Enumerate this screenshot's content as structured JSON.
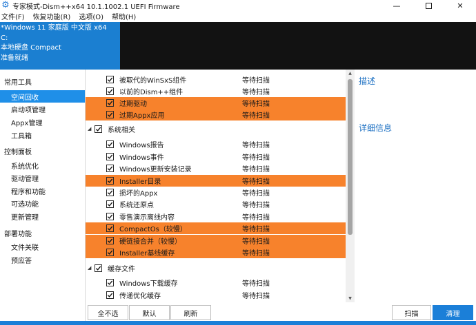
{
  "window": {
    "title": "专家模式-Dism++x64 10.1.1002.1 UEFI Firmware",
    "minimize": "—",
    "close": "✕"
  },
  "menu": [
    "文件(F)",
    "恢复功能(R)",
    "选项(O)",
    "帮助(H)"
  ],
  "header": {
    "os": "*Windows 11 家庭版 中文版 x64",
    "drive": "C:",
    "disk": "本地硬盘 Compact",
    "status": "准备就绪"
  },
  "sidebar": {
    "groups": [
      {
        "label": "常用工具",
        "items": [
          "空间回收",
          "启动项管理",
          "Appx管理",
          "工具箱"
        ]
      },
      {
        "label": "控制面板",
        "items": [
          "系统优化",
          "驱动管理",
          "程序和功能",
          "可选功能",
          "更新管理"
        ]
      },
      {
        "label": "部署功能",
        "items": [
          "文件关联",
          "预应答"
        ]
      }
    ],
    "active": "空间回收"
  },
  "list": {
    "rows": [
      {
        "type": "item",
        "name": "被取代的WinSxS组件",
        "status": "等待扫描",
        "checked": true,
        "highlight": false
      },
      {
        "type": "item",
        "name": "以前的Dism++组件",
        "status": "等待扫描",
        "checked": true,
        "highlight": false
      },
      {
        "type": "item",
        "name": "过期驱动",
        "status": "等待扫描",
        "checked": true,
        "highlight": true
      },
      {
        "type": "item",
        "name": "过期Appx应用",
        "status": "等待扫描",
        "checked": true,
        "highlight": true
      },
      {
        "type": "group",
        "name": "系统相关",
        "status": "",
        "checked": true,
        "highlight": false
      },
      {
        "type": "item",
        "name": "Windows报告",
        "status": "等待扫描",
        "checked": true,
        "highlight": false
      },
      {
        "type": "item",
        "name": "Windows事件",
        "status": "等待扫描",
        "checked": true,
        "highlight": false
      },
      {
        "type": "item",
        "name": "Windows更新安装记录",
        "status": "等待扫描",
        "checked": true,
        "highlight": false
      },
      {
        "type": "item",
        "name": "Installer目录",
        "status": "等待扫描",
        "checked": true,
        "highlight": true
      },
      {
        "type": "item",
        "name": "损坏的Appx",
        "status": "等待扫描",
        "checked": true,
        "highlight": false
      },
      {
        "type": "item",
        "name": "系统还原点",
        "status": "等待扫描",
        "checked": true,
        "highlight": false
      },
      {
        "type": "item",
        "name": "零售演示离线内容",
        "status": "等待扫描",
        "checked": true,
        "highlight": false
      },
      {
        "type": "item",
        "name": "CompactOs（较慢）",
        "status": "等待扫描",
        "checked": true,
        "highlight": true
      },
      {
        "type": "item",
        "name": "硬链接合并（较慢）",
        "status": "等待扫描",
        "checked": true,
        "highlight": true
      },
      {
        "type": "item",
        "name": "Installer基线缓存",
        "status": "等待扫描",
        "checked": true,
        "highlight": true
      },
      {
        "type": "group",
        "name": "缓存文件",
        "status": "",
        "checked": true,
        "highlight": false
      },
      {
        "type": "item",
        "name": "Windows下载缓存",
        "status": "等待扫描",
        "checked": true,
        "highlight": false
      },
      {
        "type": "item",
        "name": "传递优化缓存",
        "status": "等待扫描",
        "checked": true,
        "highlight": false
      }
    ]
  },
  "right_panel": {
    "desc_title": "描述",
    "detail_title": "详细信息"
  },
  "buttons": {
    "select_none": "全不选",
    "default": "默认",
    "refresh": "刷新",
    "scan": "扫描",
    "clean": "清理"
  },
  "colors": {
    "accent": "#1b7fd1",
    "highlight_row": "#f7822c",
    "sidebar_active": "#1f8fe8",
    "header_dark": "#121212"
  }
}
